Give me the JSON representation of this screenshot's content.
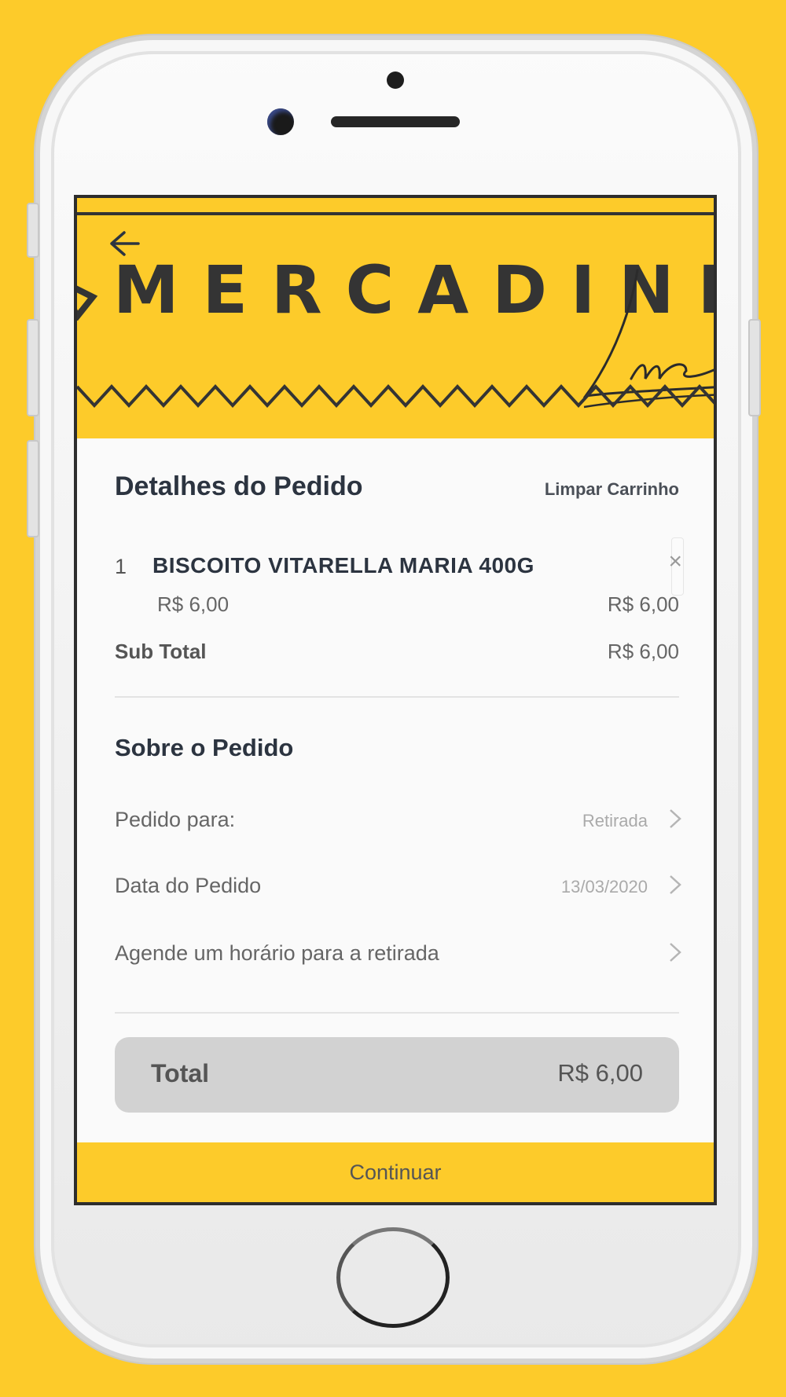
{
  "header": {
    "brand": "MERCADINH",
    "signature": "Luc",
    "colors": {
      "accent": "#FDCB2A",
      "dark": "#343434"
    }
  },
  "order": {
    "title": "Detalhes do Pedido",
    "clear_cart": "Limpar Carrinho",
    "items": [
      {
        "qty": "1",
        "name": "BISCOITO VITARELLA MARIA 400G",
        "unit_price": "R$ 6,00",
        "total": "R$ 6,00",
        "remove": "×"
      }
    ],
    "subtotal_label": "Sub Total",
    "subtotal_value": "R$ 6,00"
  },
  "about": {
    "title": "Sobre o Pedido",
    "options": [
      {
        "label": "Pedido para:",
        "value": "Retirada"
      },
      {
        "label": "Data do Pedido",
        "value": "13/03/2020"
      },
      {
        "label": "Agende um horário para a retirada",
        "value": ""
      }
    ]
  },
  "total": {
    "label": "Total",
    "value": "R$ 6,00"
  },
  "actions": {
    "continue": "Continuar"
  }
}
